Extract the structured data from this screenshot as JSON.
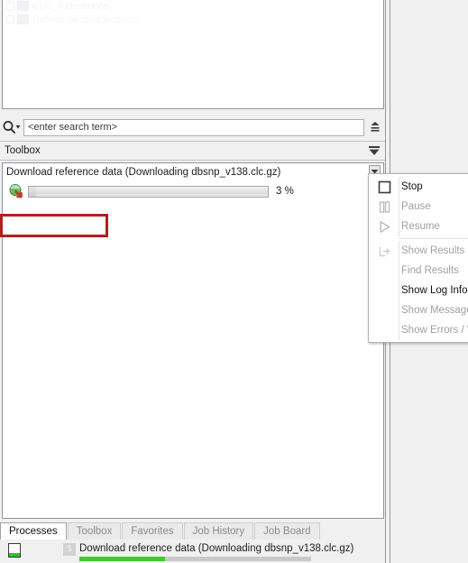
{
  "tree": {
    "rows": [
      {
        "label": "CLC_References"
      },
      {
        "label": "Reference data location"
      }
    ]
  },
  "search": {
    "placeholder": "<enter search term>",
    "value": "",
    "icon": "search-icon",
    "dropdown_icon": "chevron-down-icon",
    "collapse_icon": "collapse-all-icon"
  },
  "toolbox": {
    "title": "Toolbox",
    "menu_icon": "triangle-down-icon"
  },
  "process": {
    "title": "Download reference data (Downloading dbsnp_v138.clc.gz)",
    "icon": "download-globe-icon",
    "progress_percent": 3,
    "progress_label": "3 %",
    "menu_caret_icon": "caret-down-icon"
  },
  "context_menu": {
    "items": [
      {
        "label": "Stop",
        "icon": "stop-square-icon",
        "enabled": true,
        "highlighted": false
      },
      {
        "label": "Pause",
        "icon": "pause-bars-icon",
        "enabled": false,
        "highlighted": false
      },
      {
        "label": "Resume",
        "icon": "play-triangle-icon",
        "enabled": false,
        "highlighted": true
      },
      {
        "label": "Show Results",
        "icon": "show-results-arrow-icon",
        "enabled": false,
        "highlighted": false
      },
      {
        "label": "Find Results",
        "icon": "none",
        "enabled": false,
        "highlighted": false
      },
      {
        "label": "Show Log Information",
        "icon": "none",
        "enabled": true,
        "highlighted": false
      },
      {
        "label": "Show Messages",
        "icon": "none",
        "enabled": false,
        "highlighted": false
      },
      {
        "label": "Show Errors / Warnings",
        "icon": "none",
        "enabled": false,
        "highlighted": false
      }
    ],
    "highlight_color": "#b21f1f"
  },
  "tabs": [
    {
      "label": "Processes",
      "active": true
    },
    {
      "label": "Toolbox",
      "active": false
    },
    {
      "label": "Favorites",
      "active": false
    },
    {
      "label": "Job History",
      "active": false
    },
    {
      "label": "Job Board",
      "active": false
    }
  ],
  "footer": {
    "state_icon": "process-running-icon",
    "badge": "$",
    "label": "Download reference data (Downloading dbsnp_v138.clc.gz)",
    "progress_percent": 37,
    "progress_color": "#3dcb2d"
  }
}
